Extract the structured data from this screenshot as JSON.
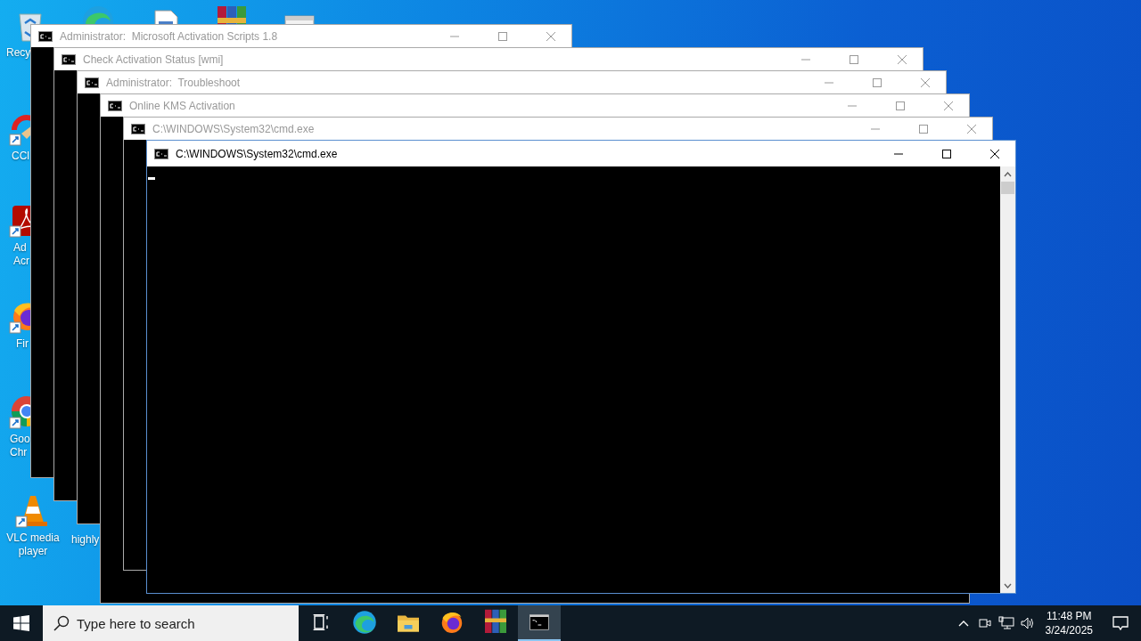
{
  "desktop_icons": [
    {
      "kind": "recycle",
      "label": "Recy"
    },
    {
      "kind": "wave"
    },
    {
      "kind": "document"
    },
    {
      "kind": "archive"
    },
    {
      "kind": "settings"
    },
    {
      "kind": "brush",
      "label": "CCl"
    },
    {
      "kind": "pdf",
      "label": "Ad\nAcr"
    },
    {
      "kind": "fox",
      "label": "Fir"
    },
    {
      "kind": "circle",
      "label": "Goo\nChr"
    },
    {
      "kind": "cone",
      "label": "VLC media player"
    },
    {
      "kind": "none",
      "label": "highly"
    }
  ],
  "windows": [
    {
      "title": "Administrator:  Microsoft Activation Scripts 1.8",
      "active": false
    },
    {
      "title": "Check Activation Status [wmi]",
      "active": false
    },
    {
      "title": "Administrator:  Troubleshoot",
      "active": false
    },
    {
      "title": "Online KMS Activation",
      "active": false
    },
    {
      "title": "C:\\WINDOWS\\System32\\cmd.exe",
      "active": false
    },
    {
      "title": "C:\\WINDOWS\\System32\\cmd.exe",
      "active": true
    }
  ],
  "taskbar": {
    "search": {
      "placeholder": "Type here to search"
    },
    "apps": [
      {
        "kind": "taskview",
        "selected": false
      },
      {
        "kind": "wave",
        "selected": false
      },
      {
        "kind": "folder",
        "selected": false
      },
      {
        "kind": "fox",
        "selected": false
      },
      {
        "kind": "archive",
        "selected": false
      },
      {
        "kind": "console",
        "selected": true
      }
    ],
    "clock": {
      "time": "11:48 PM",
      "date": "3/24/2025"
    }
  }
}
